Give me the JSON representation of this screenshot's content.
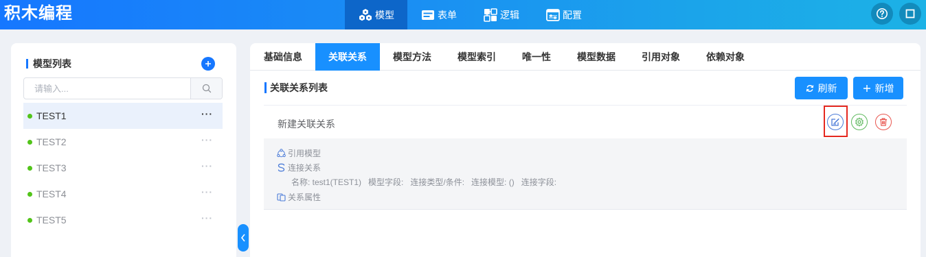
{
  "app": {
    "title": "积木编程"
  },
  "nav": {
    "items": [
      {
        "label": "模型",
        "icon": "cubes-icon"
      },
      {
        "label": "表单",
        "icon": "form-icon"
      },
      {
        "label": "逻辑",
        "icon": "logic-icon"
      },
      {
        "label": "配置",
        "icon": "config-icon"
      }
    ],
    "active": "模型"
  },
  "header_buttons": [
    "help-icon",
    "fullscreen-icon"
  ],
  "sidebar": {
    "title": "模型列表",
    "search": {
      "placeholder": "请输入...",
      "value": ""
    },
    "items": [
      {
        "label": "TEST1",
        "active": true
      },
      {
        "label": "TEST2",
        "active": false
      },
      {
        "label": "TEST3",
        "active": false
      },
      {
        "label": "TEST4",
        "active": false
      },
      {
        "label": "TEST5",
        "active": false
      }
    ],
    "more_glyph": "···"
  },
  "tabs": {
    "items": [
      "基础信息",
      "关联关系",
      "模型方法",
      "模型索引",
      "唯一性",
      "模型数据",
      "引用对象",
      "依赖对象"
    ],
    "active": "关联关系"
  },
  "main": {
    "section_title": "关联关系列表",
    "refresh_label": "刷新",
    "add_label": "新增",
    "relation": {
      "name": "新建关联关系",
      "ref_model_label": "引用模型",
      "connection_label": "连接关系",
      "connection_detail": "名称: test1(TEST1)   模型字段:   连接类型/条件:   连接模型: ()   连接字段:",
      "properties_label": "关系属性"
    }
  },
  "colors": {
    "primary": "#1890ff",
    "status_dot": "#52c41a",
    "highlight": "#e5281f",
    "edit": "#4a7bd8",
    "settings": "#5cb85c",
    "delete": "#e8554e"
  }
}
